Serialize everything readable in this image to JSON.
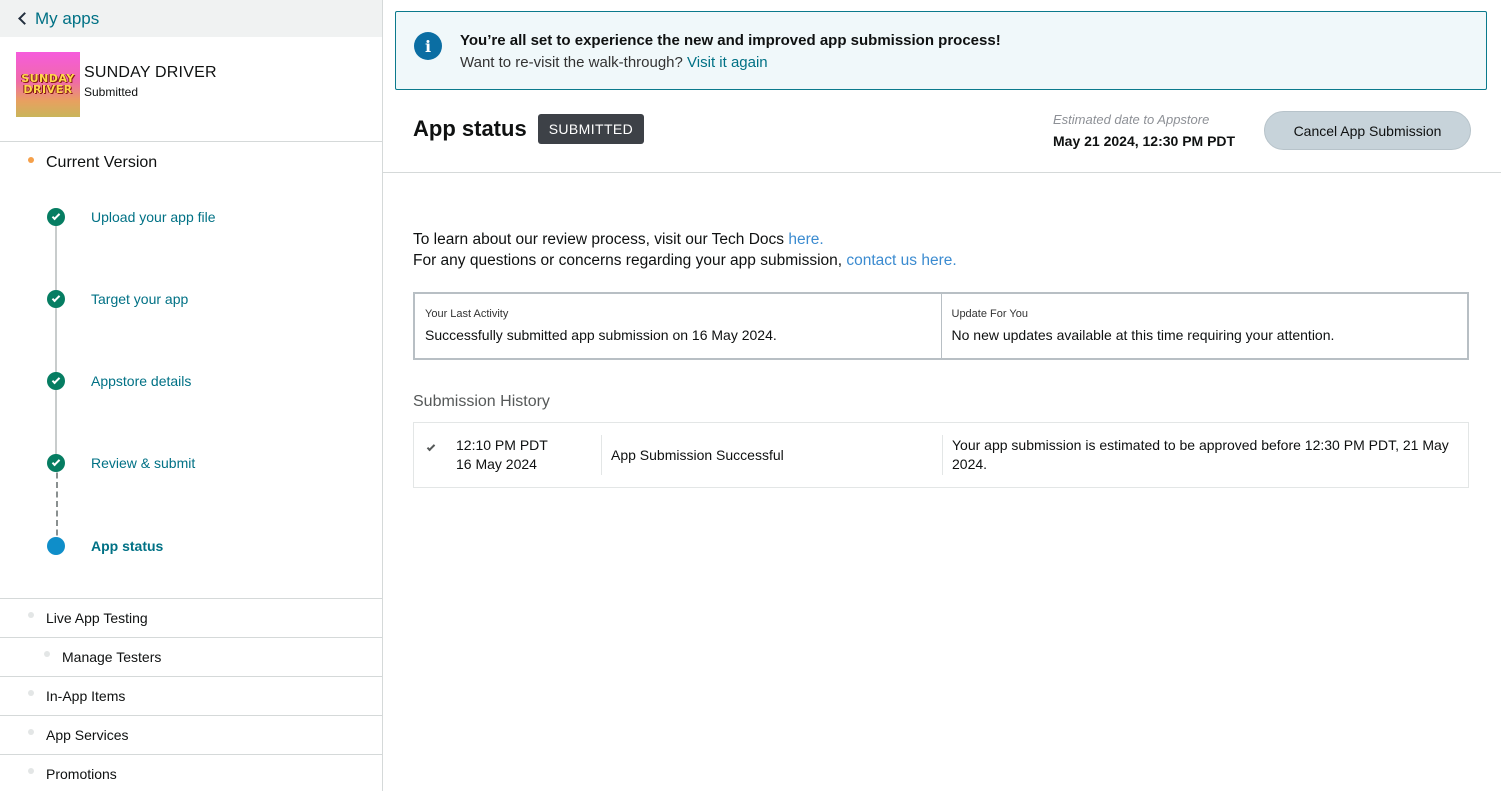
{
  "sidebar": {
    "back_label": "My apps",
    "app": {
      "name": "SUNDAY DRIVER",
      "status": "Submitted",
      "icon_text_line1": "SUNDAY",
      "icon_text_line2": "DRIVER"
    },
    "current_version_label": "Current Version",
    "steps": [
      {
        "label": "Upload your app file",
        "state": "complete"
      },
      {
        "label": "Target your app",
        "state": "complete"
      },
      {
        "label": "Appstore details",
        "state": "complete"
      },
      {
        "label": "Review & submit",
        "state": "complete"
      },
      {
        "label": "App status",
        "state": "active"
      }
    ],
    "nav_items": [
      {
        "label": "Live App Testing"
      },
      {
        "label": "Manage Testers"
      },
      {
        "label": "In-App Items"
      },
      {
        "label": "App Services"
      },
      {
        "label": "Promotions"
      }
    ]
  },
  "banner": {
    "icon": "info-icon",
    "title": "You’re all set to experience the new and improved app submission process!",
    "subtitle": "Want to re-visit the walk-through?",
    "link": "Visit it again"
  },
  "status": {
    "title": "App status",
    "badge": "SUBMITTED",
    "estimate_label": "Estimated date to Appstore",
    "estimate_value": "May 21 2024, 12:30 PM PDT",
    "cancel_button": "Cancel App Submission"
  },
  "learn": {
    "line1_text": "To learn about our review process, visit our Tech Docs ",
    "line1_link": "here.",
    "line2_text": "For any questions or concerns regarding your app submission, ",
    "line2_link": "contact us here."
  },
  "activity": {
    "last_activity_label": "Your Last Activity",
    "last_activity_value": "Successfully submitted app submission on 16 May 2024.",
    "update_label": "Update For You",
    "update_value": "No new updates available at this time requiring your attention."
  },
  "history": {
    "title": "Submission History",
    "rows": [
      {
        "time": "12:10 PM PDT",
        "date": "16 May 2024",
        "event": "App Submission Successful",
        "detail": "Your app submission is estimated to be approved before 12:30 PM PDT, 21 May 2024."
      }
    ]
  },
  "colors": {
    "link": "#007185",
    "complete": "#067d62",
    "active": "#0f8ec9",
    "badge_bg": "#3d4147",
    "banner_border": "#0b7a8c"
  }
}
